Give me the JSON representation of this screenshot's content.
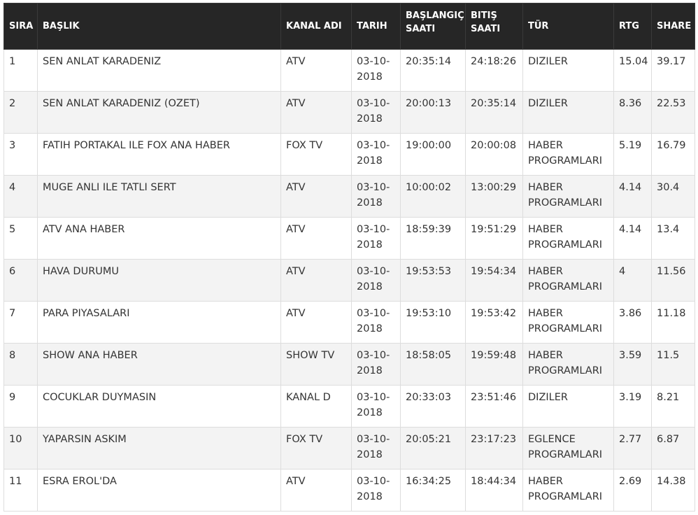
{
  "table": {
    "headers": {
      "rank": "SIRA",
      "title": "BAŞLIK",
      "channel": "KANAL ADI",
      "date": "TARIH",
      "start_line1": "BAŞLANGIÇ",
      "start_line2": "SAATI",
      "end_line1": "BITIŞ",
      "end_line2": "SAATI",
      "genre": "TÜR",
      "rating": "RTG",
      "share": "SHARE"
    },
    "rows": [
      {
        "rank": "1",
        "title": "SEN ANLAT KARADENIZ",
        "channel": "ATV",
        "date_line1": "03-10-",
        "date_line2": "2018",
        "start": "20:35:14",
        "end": "24:18:26",
        "genre_line1": "DIZILER",
        "genre_line2": "",
        "rating": "15.04",
        "share": "39.17"
      },
      {
        "rank": "2",
        "title": "SEN ANLAT KARADENIZ (OZET)",
        "channel": "ATV",
        "date_line1": "03-10-",
        "date_line2": "2018",
        "start": "20:00:13",
        "end": "20:35:14",
        "genre_line1": "DIZILER",
        "genre_line2": "",
        "rating": "8.36",
        "share": "22.53"
      },
      {
        "rank": "3",
        "title": "FATIH PORTAKAL ILE FOX ANA HABER",
        "channel": "FOX TV",
        "date_line1": "03-10-",
        "date_line2": "2018",
        "start": "19:00:00",
        "end": "20:00:08",
        "genre_line1": "HABER",
        "genre_line2": "PROGRAMLARI",
        "rating": "5.19",
        "share": "16.79"
      },
      {
        "rank": "4",
        "title": "MUGE ANLI ILE TATLI SERT",
        "channel": "ATV",
        "date_line1": "03-10-",
        "date_line2": "2018",
        "start": "10:00:02",
        "end": "13:00:29",
        "genre_line1": "HABER",
        "genre_line2": "PROGRAMLARI",
        "rating": "4.14",
        "share": "30.4"
      },
      {
        "rank": "5",
        "title": "ATV ANA HABER",
        "channel": "ATV",
        "date_line1": "03-10-",
        "date_line2": "2018",
        "start": "18:59:39",
        "end": "19:51:29",
        "genre_line1": "HABER",
        "genre_line2": "PROGRAMLARI",
        "rating": "4.14",
        "share": "13.4"
      },
      {
        "rank": "6",
        "title": "HAVA DURUMU",
        "channel": "ATV",
        "date_line1": "03-10-",
        "date_line2": "2018",
        "start": "19:53:53",
        "end": "19:54:34",
        "genre_line1": "HABER",
        "genre_line2": "PROGRAMLARI",
        "rating": "4",
        "share": "11.56"
      },
      {
        "rank": "7",
        "title": "PARA PIYASALARI",
        "channel": "ATV",
        "date_line1": "03-10-",
        "date_line2": "2018",
        "start": "19:53:10",
        "end": "19:53:42",
        "genre_line1": "HABER",
        "genre_line2": "PROGRAMLARI",
        "rating": "3.86",
        "share": "11.18"
      },
      {
        "rank": "8",
        "title": "SHOW ANA HABER",
        "channel": "SHOW TV",
        "date_line1": "03-10-",
        "date_line2": "2018",
        "start": "18:58:05",
        "end": "19:59:48",
        "genre_line1": "HABER",
        "genre_line2": "PROGRAMLARI",
        "rating": "3.59",
        "share": "11.5"
      },
      {
        "rank": "9",
        "title": "COCUKLAR DUYMASIN",
        "channel": "KANAL D",
        "date_line1": "03-10-",
        "date_line2": "2018",
        "start": "20:33:03",
        "end": "23:51:46",
        "genre_line1": "DIZILER",
        "genre_line2": "",
        "rating": "3.19",
        "share": "8.21"
      },
      {
        "rank": "10",
        "title": "YAPARSIN ASKIM",
        "channel": "FOX TV",
        "date_line1": "03-10-",
        "date_line2": "2018",
        "start": "20:05:21",
        "end": "23:17:23",
        "genre_line1": "EGLENCE",
        "genre_line2": "PROGRAMLARI",
        "rating": "2.77",
        "share": "6.87"
      },
      {
        "rank": "11",
        "title": "ESRA EROL'DA",
        "channel": "ATV",
        "date_line1": "03-10-",
        "date_line2": "2018",
        "start": "16:34:25",
        "end": "18:44:34",
        "genre_line1": "HABER",
        "genre_line2": "PROGRAMLARI",
        "rating": "2.69",
        "share": "14.38"
      }
    ]
  }
}
